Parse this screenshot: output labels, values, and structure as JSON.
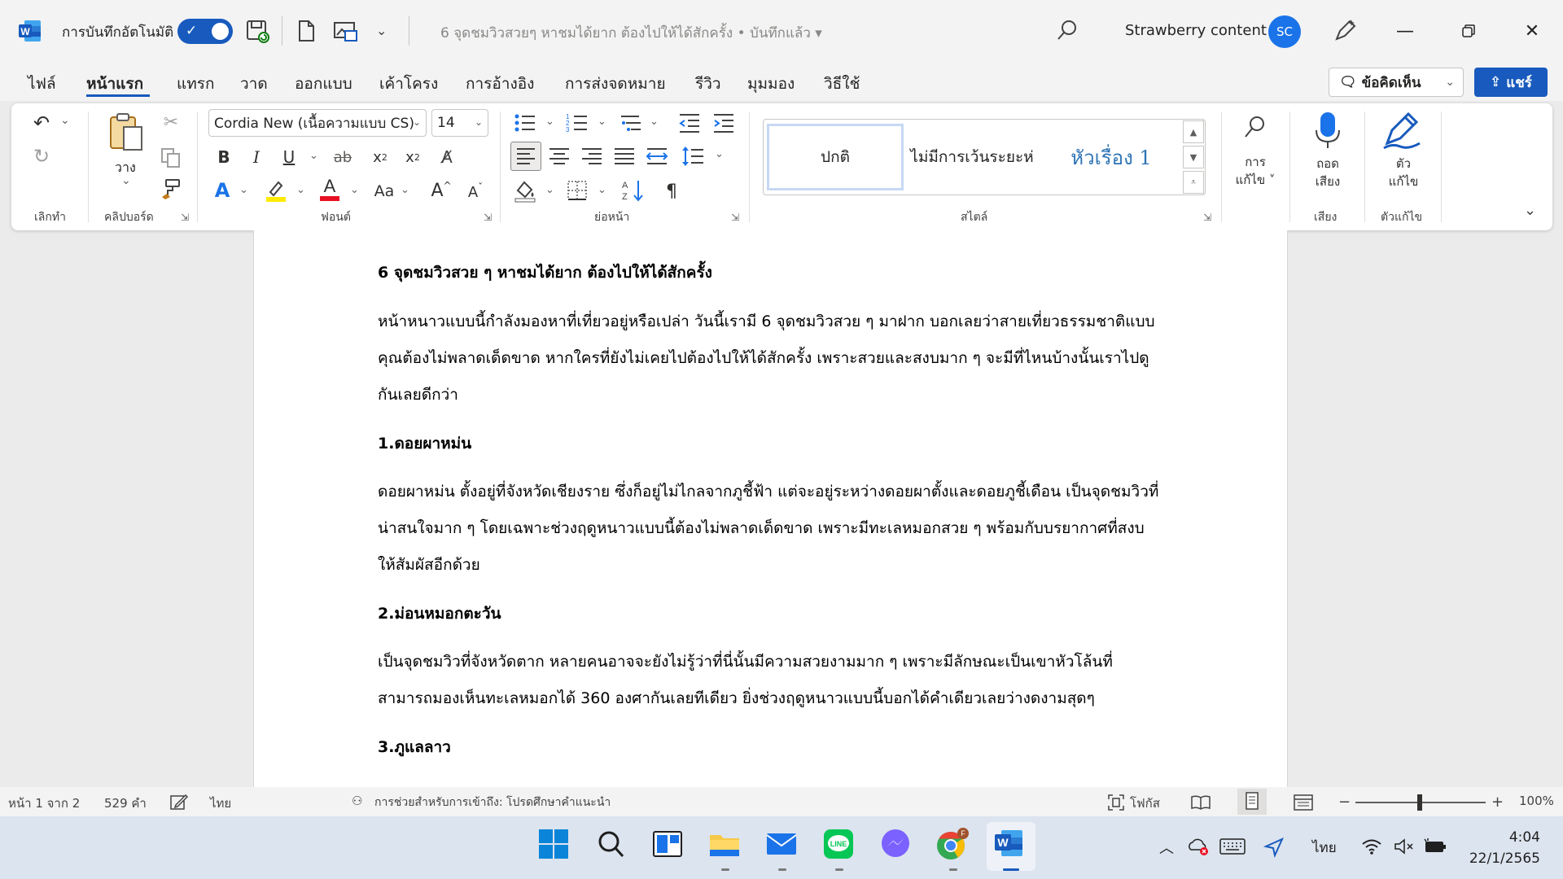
{
  "titlebar": {
    "autosave_label": "การบันทึกอัตโนมัติ",
    "doc_title": "6 จุดชมวิวสวยๆ หาชมได้ยาก ต้องไปให้ได้สักครั้ง • บันทึกแล้ว ▾",
    "user_name": "Strawberry content",
    "user_initials": "SC"
  },
  "tabs": [
    {
      "label": "ไฟล์"
    },
    {
      "label": "หน้าแรก"
    },
    {
      "label": "แทรก"
    },
    {
      "label": "วาด"
    },
    {
      "label": "ออกแบบ"
    },
    {
      "label": "เค้าโครง"
    },
    {
      "label": "การอ้างอิง"
    },
    {
      "label": "การส่งจดหมาย"
    },
    {
      "label": "รีวิว"
    },
    {
      "label": "มุมมอง"
    },
    {
      "label": "วิธีใช้"
    }
  ],
  "comments_label": "ข้อคิดเห็น",
  "share_label": "แชร์",
  "ribbon": {
    "undo_group": "เลิกทำ",
    "clipboard_group": "คลิปบอร์ด",
    "paste_label": "วาง",
    "font_group": "ฟอนต์",
    "paragraph_group": "ย่อหน้า",
    "styles_group": "สไตล์",
    "voice_group": "เสียง",
    "editor_group": "ตัวแก้ไข",
    "font_name": "Cordia New (เนื้อความแบบ CS)",
    "font_size": "14",
    "styles": [
      "ปกติ",
      "ไม่มีการเว้นระยะห่",
      "หัวเรื่อง 1"
    ],
    "editing_label_1": "การ",
    "editing_label_2": "แก้ไข ˅",
    "dictate_label_1": "ถอด",
    "dictate_label_2": "เสียง",
    "editor_label_1": "ตัว",
    "editor_label_2": "แก้ไข"
  },
  "document": {
    "title": "6 จุดชมวิวสวย ๆ หาชมได้ยาก ต้องไปให้ได้สักครั้ง",
    "intro": [
      "หน้าหนาวแบบนี้กำลังมองหาที่เที่ยวอยู่หรือเปล่า วันนี้เรามี 6 จุดชมวิวสวย ๆ มาฝาก บอกเลยว่าสายเที่ยวธรรมชาติแบบ",
      "คุณต้องไม่พลาดเด็ดขาด หากใครที่ยังไม่เคยไปต้องไปให้ได้สักครั้ง เพราะสวยและสงบมาก ๆ จะมีที่ไหนบ้างนั้นเราไปดู",
      "กันเลยดีกว่า"
    ],
    "h1": "1.ดอยผาหม่น",
    "p1": [
      "ดอยผาหม่น ตั้งอยู่ที่จังหวัดเชียงราย ซึ่งก็อยู่ไม่ไกลจากภูชี้ฟ้า แต่จะอยู่ระหว่างดอยผาตั้งและดอยภูชี้เดือน เป็นจุดชมวิวที่",
      "น่าสนใจมาก ๆ โดยเฉพาะช่วงฤดูหนาวแบบนี้ต้องไม่พลาดเด็ดขาด เพราะมีทะเลหมอกสวย ๆ พร้อมกับบรยากาศที่สงบ",
      "ให้สัมผัสอีกด้วย"
    ],
    "h2": "2.ม่อนหมอกตะวัน",
    "p2": [
      "เป็นจุดชมวิวที่จังหวัดตาก หลายคนอาจจะยังไม่รู้ว่าที่นี่นั้นมีความสวยงามมาก ๆ เพราะมีลักษณะเป็นเขาหัวโล้นที่",
      "สามารถมองเห็นทะเลหมอกได้ 360 องศากันเลยทีเดียว ยิ่งช่วงฤดูหนาวแบบนี้บอกได้คำเดียวเลยว่างดงามสุดๆ"
    ],
    "h3": "3.ภูแลลาว"
  },
  "statusbar": {
    "page": "หน้า 1 จาก 2",
    "words": "529 คำ",
    "language": "ไทย",
    "accessibility": "การช่วยสำหรับการเข้าถึง: โปรดศึกษาคำแนะนำ",
    "focus": "โฟกัส",
    "zoom": "100%"
  },
  "taskbar": {
    "input_lang": "ไทย",
    "time": "4:04",
    "date": "22/1/2565"
  },
  "colors": {
    "accent": "#185abd",
    "titlebar_bg": "#f3f3f3",
    "taskbar_bg": "#dce4ef"
  }
}
